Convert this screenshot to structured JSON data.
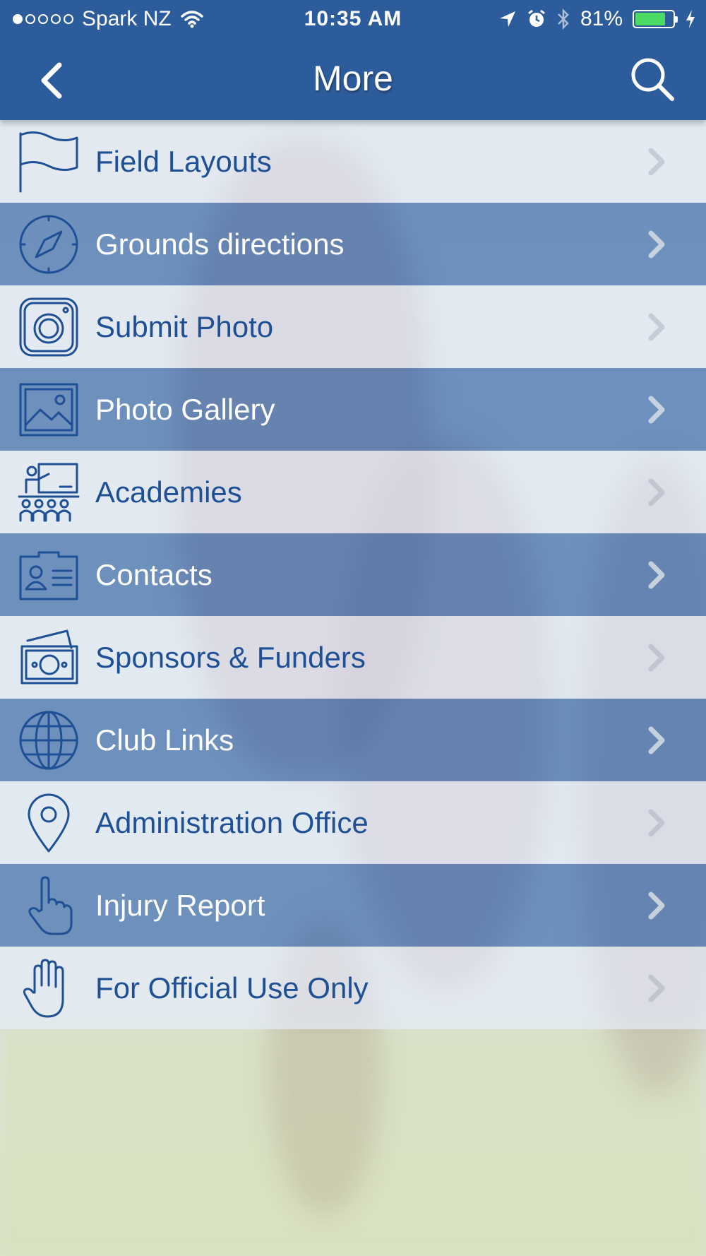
{
  "status_bar": {
    "carrier": "Spark NZ",
    "time": "10:35 AM",
    "battery": "81%",
    "battery_level": 0.81
  },
  "navbar": {
    "title": "More"
  },
  "menu": {
    "items": [
      {
        "label": "Field Layouts",
        "icon": "flag-icon"
      },
      {
        "label": "Grounds directions",
        "icon": "compass-icon"
      },
      {
        "label": "Submit Photo",
        "icon": "camera-icon"
      },
      {
        "label": "Photo Gallery",
        "icon": "picture-icon"
      },
      {
        "label": "Academies",
        "icon": "classroom-icon"
      },
      {
        "label": "Contacts",
        "icon": "contact-card-icon"
      },
      {
        "label": "Sponsors & Funders",
        "icon": "money-icon"
      },
      {
        "label": "Club Links",
        "icon": "globe-icon"
      },
      {
        "label": "Administration Office",
        "icon": "location-pin-icon"
      },
      {
        "label": "Injury Report",
        "icon": "pointing-hand-icon"
      },
      {
        "label": "For Official Use Only",
        "icon": "raised-hand-icon"
      }
    ]
  },
  "colors": {
    "nav_bar": "#2d5c9d",
    "row_dark": "#4370aa",
    "row_light": "#e4ecf4",
    "text_blue": "#1f4f94",
    "battery_green": "#4cd964"
  }
}
